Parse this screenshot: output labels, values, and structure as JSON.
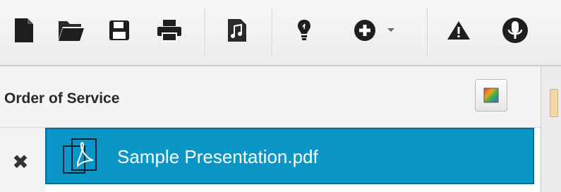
{
  "toolbar": {
    "buttons": [
      {
        "name": "new-document-icon",
        "interactable": true
      },
      {
        "name": "open-folder-icon",
        "interactable": true
      },
      {
        "name": "save-icon",
        "interactable": true
      },
      {
        "name": "print-icon",
        "interactable": true
      },
      {
        "name": "song-file-icon",
        "interactable": true
      },
      {
        "name": "lightbulb-icon",
        "interactable": true
      },
      {
        "name": "add-circle-icon",
        "interactable": true
      },
      {
        "name": "warning-icon",
        "interactable": true
      },
      {
        "name": "microphone-icon",
        "interactable": true
      }
    ]
  },
  "panel": {
    "title": "Order of Service",
    "remove_glyph": "✖",
    "items": [
      {
        "label": "Sample Presentation.pdf",
        "icon": "pdf-file-icon",
        "selected": true
      }
    ]
  },
  "colors": {
    "selection": "#0a96c6",
    "selection_border": "#0a6e94",
    "toolbar_bg": "#efefef"
  }
}
